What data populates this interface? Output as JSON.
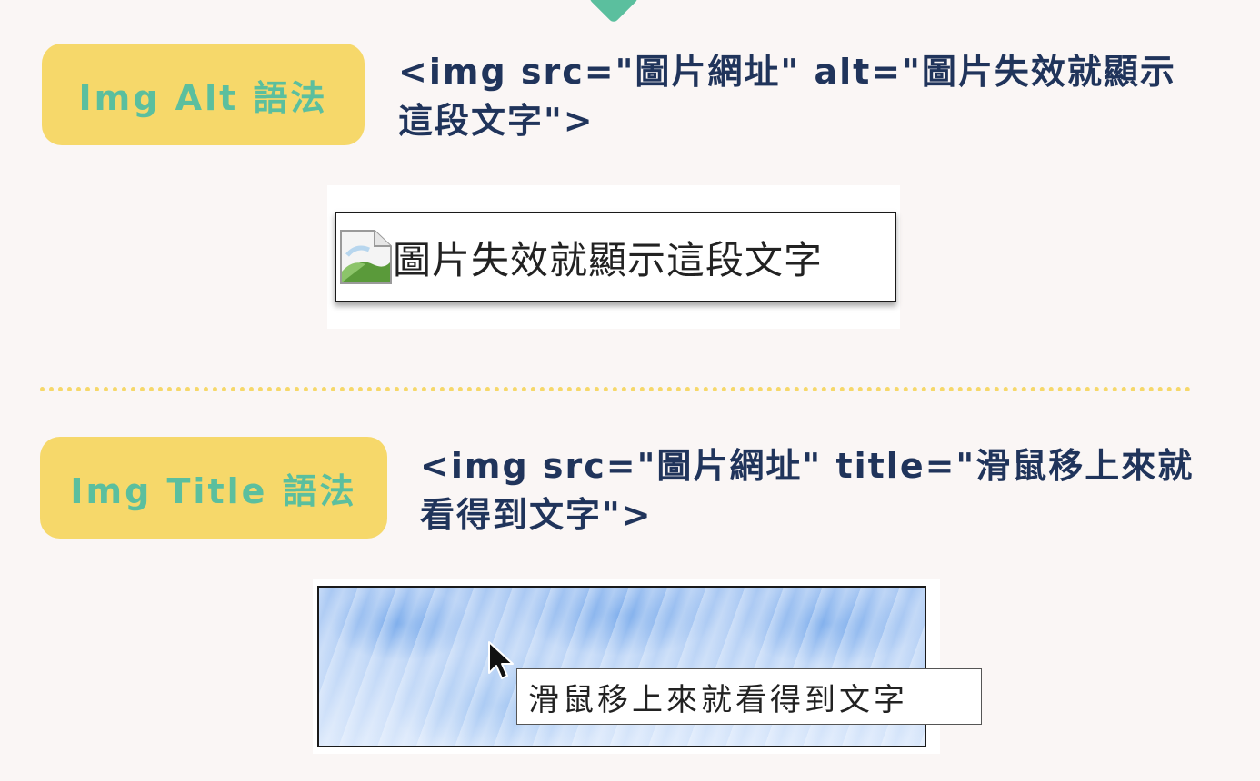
{
  "sections": [
    {
      "label": "Img Alt 語法",
      "code": "<img src=\"圖片網址\" alt=\"圖片失效就顯示這段文字\">",
      "demo_text": "圖片失效就顯示這段文字"
    },
    {
      "label": "Img Title 語法",
      "code": "<img src=\"圖片網址\" title=\"滑鼠移上來就看得到文字\">",
      "tooltip_text": "滑鼠移上來就看得到文字"
    }
  ],
  "colors": {
    "background": "#faf6f5",
    "pill": "#f6d86a",
    "pill_text": "#5bbf9e",
    "code_text": "#20345b",
    "divider": "#f6d86a"
  },
  "icons": [
    "broken-image-icon",
    "mouse-cursor-icon",
    "down-arrow-icon"
  ]
}
